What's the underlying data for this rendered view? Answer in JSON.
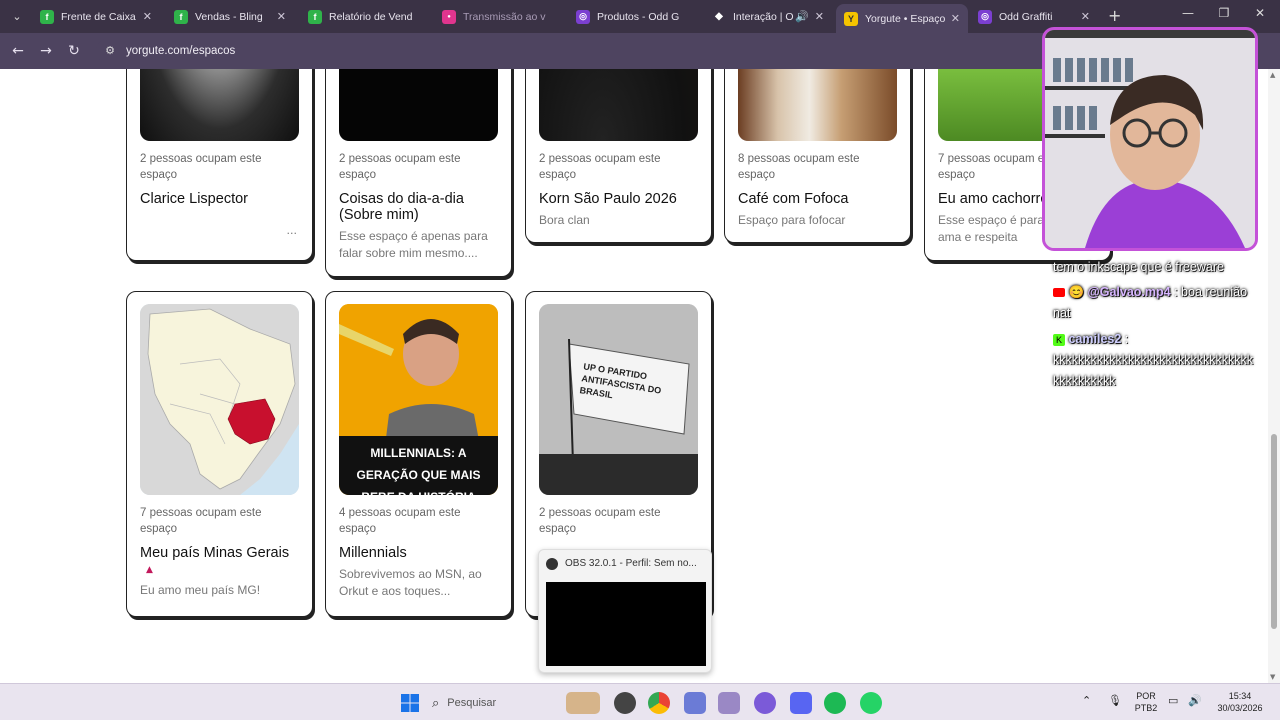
{
  "browser": {
    "tabs": [
      {
        "label": "Frente de Caixa -",
        "color": "#2fb34a",
        "glyph": "f"
      },
      {
        "label": "Vendas - Bling",
        "color": "#2fb34a",
        "glyph": "f"
      },
      {
        "label": "Relatório de Vend",
        "color": "#2fb34a",
        "glyph": "f"
      },
      {
        "label": "Transmissão ao v",
        "color": "#e0358e",
        "glyph": "●"
      },
      {
        "label": "Produtos - Odd G",
        "color": "#7b3fd1",
        "glyph": "◎"
      },
      {
        "label": "Interação | O",
        "color": "#ffffff",
        "glyph": "◆"
      },
      {
        "label": "Yorgute • Espaços",
        "color": "#f5c400",
        "glyph": "Y"
      },
      {
        "label": "Odd Graffiti",
        "color": "#7b3fd1",
        "glyph": "◎"
      }
    ],
    "close_glyph": "✕",
    "new_tab_glyph": "+",
    "url": "yorgute.com/espacos"
  },
  "cards": [
    {
      "occupancy": "2 pessoas ocupam este espaço",
      "title": "Clarice Lispector",
      "desc": "",
      "more": "..."
    },
    {
      "occupancy": "2 pessoas ocupam este espaço",
      "title": "Coisas do dia-a-dia (Sobre mim)",
      "desc": "Esse espaço é apenas para falar sobre mim mesmo...."
    },
    {
      "occupancy": "2 pessoas ocupam este espaço",
      "title": "Korn São Paulo 2026",
      "desc": "Bora clan"
    },
    {
      "occupancy": "8 pessoas ocupam este espaço",
      "title": "Café com Fofoca",
      "desc": "Espaço para fofocar"
    },
    {
      "occupancy": "7 pessoas ocupam este espaço",
      "title": "Eu amo cachorros",
      "desc": "Esse espaço é para quem ama e respeita"
    },
    {
      "occupancy": "7 pessoas ocupam este espaço",
      "title": "Meu país Minas Gerais",
      "desc": "Eu amo meu país MG!"
    },
    {
      "occupancy": "4 pessoas ocupam este espaço",
      "title": "Millennials",
      "desc": "Sobrevivemos ao MSN, ao Orkut e aos toques...",
      "thumb_text": "MILLENNIALS: A GERAÇÃO QUE MAIS BEBE DA HISTÓRIA"
    },
    {
      "occupancy": "2 pessoas ocupam este espaço",
      "title": "",
      "desc": "",
      "thumb_text": "UP O PARTIDO ANTIFASCISTA DO BRASIL"
    }
  ],
  "chat": {
    "line1": "tem o inkscape que é freeware",
    "msg2_user": "@Galvao.mp4",
    "msg2_text": ": boa reunião nat",
    "msg3_user": "camiles2",
    "msg3_text": ":",
    "msg3_body": "kkkkkkkkkkkkkkkkkkkkkkkkkkkkkkkkkkkkkkkkkk"
  },
  "obs_popup": {
    "title": "OBS 32.0.1 - Perfil: Sem no..."
  },
  "taskbar": {
    "search_placeholder": "Pesquisar",
    "lang_top": "POR",
    "lang_bottom": "PTB2",
    "time": "15:34",
    "date": "30/03/2026"
  }
}
